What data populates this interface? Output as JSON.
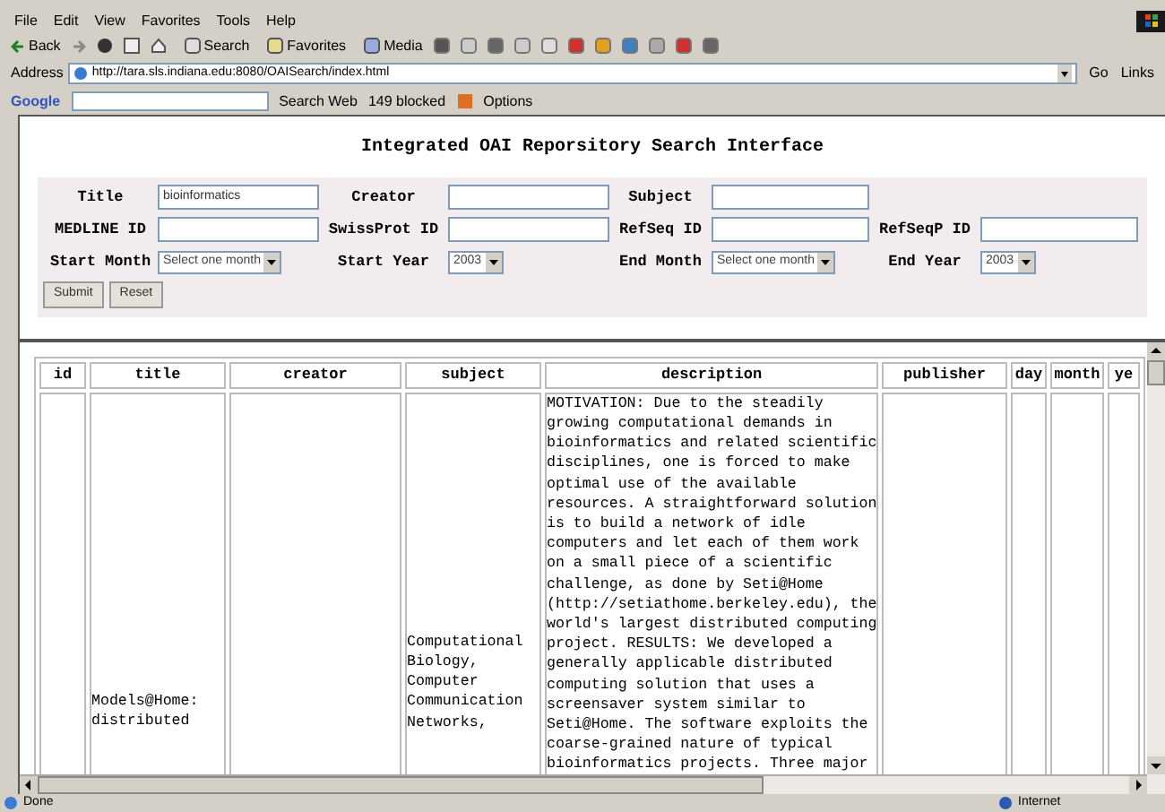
{
  "menu": [
    "File",
    "Edit",
    "View",
    "Favorites",
    "Tools",
    "Help"
  ],
  "toolbar": {
    "back": "Back",
    "search": "Search",
    "favorites": "Favorites",
    "media": "Media"
  },
  "address": {
    "label": "Address",
    "url": "http://tara.sls.indiana.edu:8080/OAISearch/index.html",
    "go": "Go",
    "links": "Links"
  },
  "google_bar": {
    "logo": "Google",
    "search_web": "Search Web",
    "blocked": "149 blocked",
    "options": "Options"
  },
  "page_title": "Integrated OAI Reporsitory Search Interface",
  "form": {
    "rows": [
      [
        {
          "label": "Title",
          "kind": "input",
          "value": "bioinformatics"
        },
        {
          "label": "Creator",
          "kind": "input"
        },
        {
          "label": "Subject",
          "kind": "input"
        }
      ],
      [
        {
          "label": "MEDLINE ID",
          "kind": "input"
        },
        {
          "label": "SwissProt ID",
          "kind": "input"
        },
        {
          "label": "RefSeq ID",
          "kind": "input"
        },
        {
          "label": "RefSeqP ID",
          "kind": "input"
        }
      ],
      [
        {
          "label": "Start Month",
          "kind": "select",
          "value": "Select one month"
        },
        {
          "label": "Start Year",
          "kind": "select",
          "value": "2003"
        },
        {
          "label": "End Month",
          "kind": "select",
          "value": "Select one month"
        },
        {
          "label": "End Year",
          "kind": "select",
          "value": "2003"
        }
      ]
    ],
    "buttons": [
      "Submit",
      "Reset"
    ]
  },
  "table": {
    "columns": [
      "id",
      "title",
      "creator",
      "subject",
      "description",
      "publisher",
      "day",
      "month",
      "ye"
    ],
    "rows": [
      {
        "title": [
          "Models@Home:",
          "distributed"
        ],
        "subject": [
          "Computational",
          "Biology,",
          "Computer",
          "Communication",
          "Networks,"
        ],
        "description": [
          "MOTIVATION: Due to the steadily",
          "growing computational demands in",
          "bioinformatics and related scientific",
          "disciplines, one is forced to make",
          "optimal use of the available",
          "resources. A straightforward solution",
          "is to build a network of idle",
          "computers and let each of them work",
          "on a small piece of a scientific",
          "challenge, as done by Seti@Home",
          "(http://setiathome.berkeley.edu), the",
          "world's largest distributed computing",
          "project. RESULTS: We developed a",
          "generally applicable distributed",
          "computing solution that uses a",
          "screensaver system similar to",
          "Seti@Home. The software exploits the",
          "coarse-grained nature of typical",
          "bioinformatics projects. Three major"
        ]
      }
    ]
  },
  "status_bar": {
    "text": "Done",
    "zone": "Internet"
  }
}
